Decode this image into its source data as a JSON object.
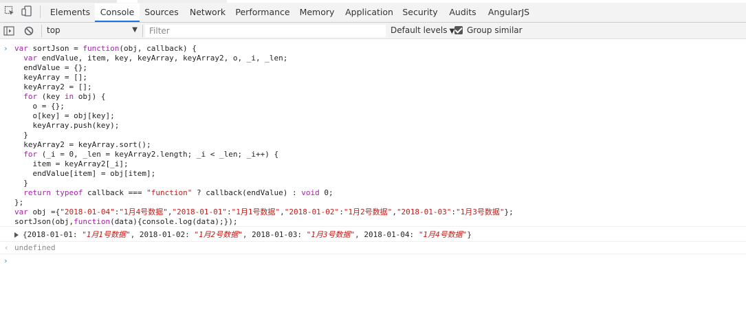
{
  "tabs": [
    "Elements",
    "Console",
    "Sources",
    "Network",
    "Performance",
    "Memory",
    "Application",
    "Security",
    "Audits",
    "AngularJS"
  ],
  "active_tab": "Console",
  "toolbar": {
    "context": "top",
    "filter_placeholder": "Filter",
    "levels": "Default levels",
    "group_similar": "Group similar",
    "group_similar_checked": true
  },
  "input_code": [
    "var sortJson = function(obj, callback) {",
    "  var endValue, item, key, keyArray, keyArray2, o, _i, _len;",
    "  endValue = {};",
    "  keyArray = [];",
    "  keyArray2 = [];",
    "  for (key in obj) {",
    "    o = {};",
    "    o[key] = obj[key];",
    "    keyArray.push(key);",
    "  }",
    "  keyArray2 = keyArray.sort();",
    "  for (_i = 0, _len = keyArray2.length; _i < _len; _i++) {",
    "    item = keyArray2[_i];",
    "    endValue[item] = obj[item];",
    "  }",
    "  return typeof callback === \"function\" ? callback(endValue) : void 0;",
    "};",
    "var obj ={\"2018-01-04\":\"1月4号数据\",\"2018-01-01\":\"1月1号数据\",\"2018-01-02\":\"1月2号数据\",\"2018-01-03\":\"1月3号数据\"};",
    "sortJson(obj,function(data){console.log(data);});"
  ],
  "log_output": {
    "open": "{",
    "entries": [
      {
        "key": "2018-01-01",
        "value": "\"1月1号数据\""
      },
      {
        "key": "2018-01-02",
        "value": "\"1月2号数据\""
      },
      {
        "key": "2018-01-03",
        "value": "\"1月3号数据\""
      },
      {
        "key": "2018-01-04",
        "value": "\"1月4号数据\""
      }
    ],
    "close": "}"
  },
  "return_value": "undefined",
  "prompt_symbol": "›",
  "return_symbol": "‹"
}
